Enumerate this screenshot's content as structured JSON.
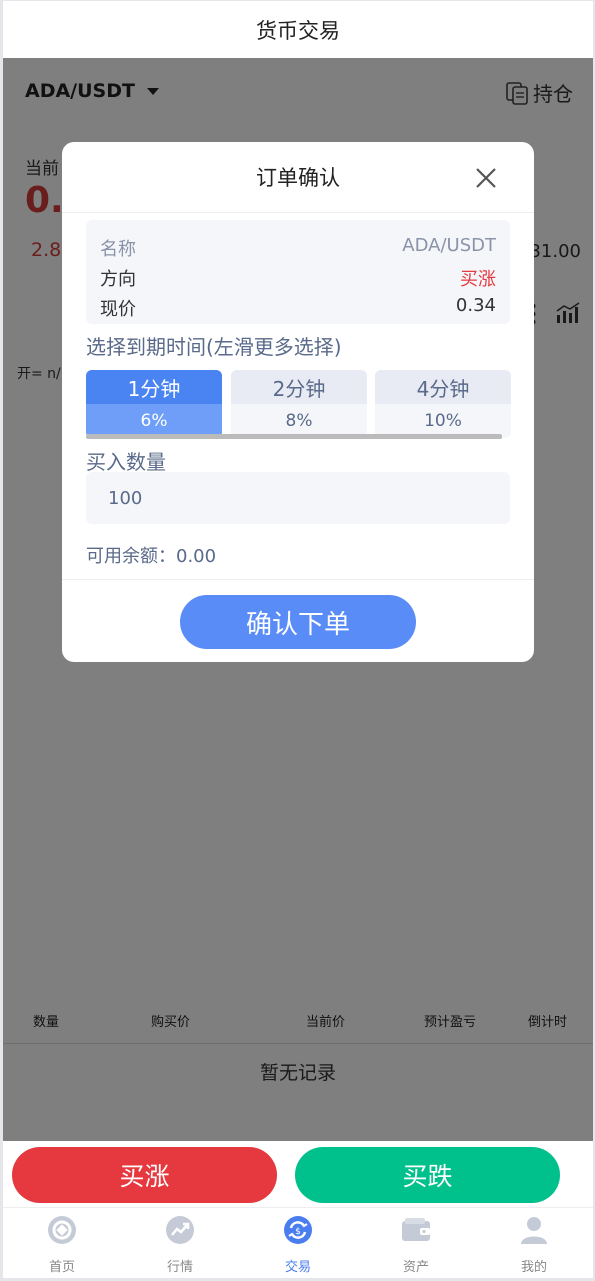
{
  "header": {
    "title": "货币交易"
  },
  "pair": {
    "name": "ADA/USDT",
    "holdings_label": "持仓"
  },
  "quote": {
    "label": "当前",
    "price": "0.3",
    "change": "2.8",
    "high": "31.00",
    "ohlc": "开= n/"
  },
  "records": {
    "columns": [
      "数量",
      "购买价",
      "当前价",
      "预计盈亏",
      "倒计时"
    ],
    "empty_text": "暂无记录"
  },
  "actions": {
    "buy_up": "买涨",
    "buy_down": "买跌"
  },
  "tabs": [
    {
      "label": "首页",
      "icon": "home-icon",
      "active": false
    },
    {
      "label": "行情",
      "icon": "market-icon",
      "active": false
    },
    {
      "label": "交易",
      "icon": "trade-icon",
      "active": true
    },
    {
      "label": "资产",
      "icon": "wallet-icon",
      "active": false
    },
    {
      "label": "我的",
      "icon": "profile-icon",
      "active": false
    }
  ],
  "modal": {
    "title": "订单确认",
    "info": {
      "name_label": "名称",
      "name_value": "ADA/USDT",
      "direction_label": "方向",
      "direction_value": "买涨",
      "price_label": "现价",
      "price_value": "0.34"
    },
    "expiry_label": "选择到期时间(左滑更多选择)",
    "expiry_options": [
      {
        "time": "1分钟",
        "rate": "6%",
        "selected": true
      },
      {
        "time": "2分钟",
        "rate": "8%",
        "selected": false
      },
      {
        "time": "4分钟",
        "rate": "10%",
        "selected": false
      }
    ],
    "quantity_label": "买入数量",
    "quantity_value": "100",
    "balance_text": "可用余额：0.00",
    "confirm_label": "确认下单"
  },
  "colors": {
    "up": "#e5383f",
    "down": "#00c08b",
    "accent": "#5a8cf8",
    "tab_active": "#4a7ef0"
  }
}
